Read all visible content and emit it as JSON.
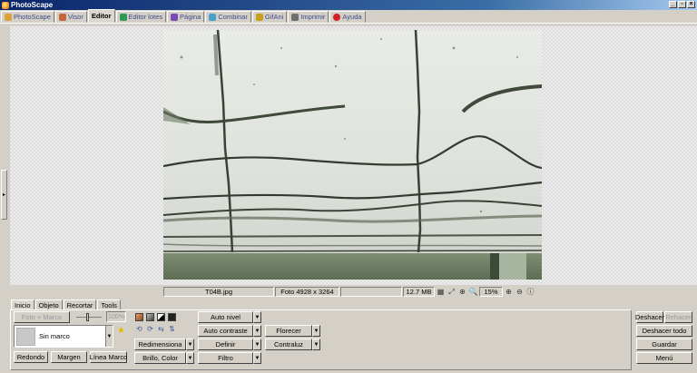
{
  "window": {
    "title": "PhotoScape"
  },
  "window_buttons": [
    "_",
    "▫",
    "×"
  ],
  "tabs": [
    {
      "label": "PhotoScape",
      "color": "#d9a23a"
    },
    {
      "label": "Visor",
      "color": "#c8643c"
    },
    {
      "label": "Editor",
      "color": "#3c7ad0"
    },
    {
      "label": "Editor lotes",
      "color": "#2f9a56"
    },
    {
      "label": "Página",
      "color": "#7a4ab2"
    },
    {
      "label": "Combinar",
      "color": "#4aa0c8"
    },
    {
      "label": "GifAni",
      "color": "#c8a020"
    },
    {
      "label": "Imprimir",
      "color": "#707070"
    },
    {
      "label": "Ayuda",
      "color": "#d02020"
    }
  ],
  "status": {
    "filename": "T04B.jpg",
    "photo_info": "Foto 4928 x 3264",
    "empty": "",
    "file_size": "12.7 MB",
    "zoom": "15%"
  },
  "bottom_tabs": [
    "Inicio",
    "Objeto",
    "Recortar",
    "Tools"
  ],
  "home": {
    "photo_frame_button": "Foto + Marco",
    "frame_percent": "100%",
    "frame_name": "Sin marco",
    "round_button": "Redondo",
    "margin_button": "Margen",
    "frame_line_button": "Línea Marco"
  },
  "tools": {
    "auto_level": "Auto nivel",
    "auto_contrast": "Auto contraste",
    "resize": "Redimensiona",
    "sharpen": "Definir",
    "bloom": "Florecer",
    "brightness_color": "Brillo, Color",
    "filter": "Filtro",
    "backlight": "Contraluz"
  },
  "actions": {
    "undo": "Deshacer",
    "redo": "Rehacer",
    "undo_all": "Deshacer todo",
    "save": "Guardar",
    "menu": "Menú"
  },
  "colors": {
    "accent": "#0a246a",
    "face": "#d4d0c8"
  }
}
